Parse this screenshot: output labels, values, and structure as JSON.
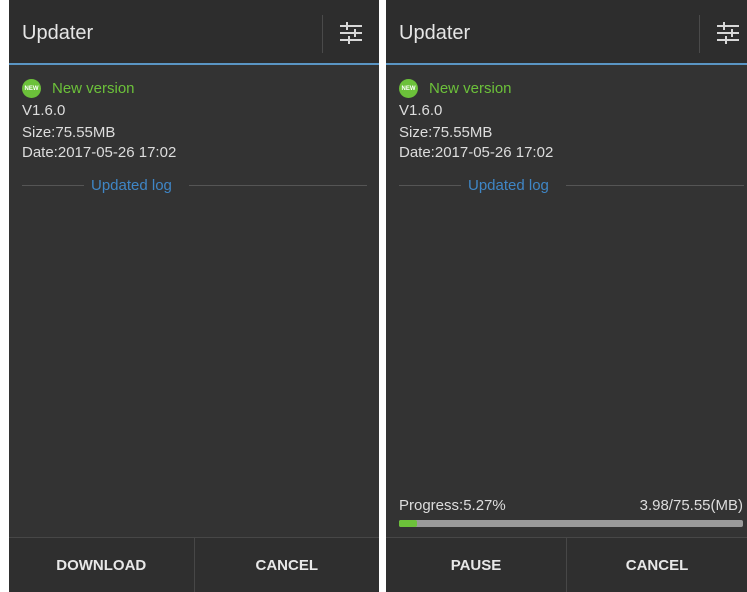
{
  "screens": [
    {
      "app_title": "Updater",
      "settings_icon": "settings-sliders-icon",
      "badge_text": "NEW",
      "new_version_label": "New version",
      "version": "V1.6.0",
      "size": "Size:75.55MB",
      "date": "Date:2017-05-26 17:02",
      "log_label": "Updated log",
      "buttons": {
        "primary": "DOWNLOAD",
        "cancel": "CANCEL"
      }
    },
    {
      "app_title": "Updater",
      "settings_icon": "settings-sliders-icon",
      "badge_text": "NEW",
      "new_version_label": "New version",
      "version": "V1.6.0",
      "size": "Size:75.55MB",
      "date": "Date:2017-05-26 17:02",
      "log_label": "Updated log",
      "progress": {
        "label": "Progress:5.27%",
        "size_text": "3.98/75.55(MB)",
        "fraction": 0.0527
      },
      "buttons": {
        "primary": "PAUSE",
        "cancel": "CANCEL"
      }
    }
  ],
  "colors": {
    "accent_green": "#6cc13a",
    "link_blue": "#3f86c6",
    "header_line": "#5a95c4",
    "background": "#333333"
  }
}
